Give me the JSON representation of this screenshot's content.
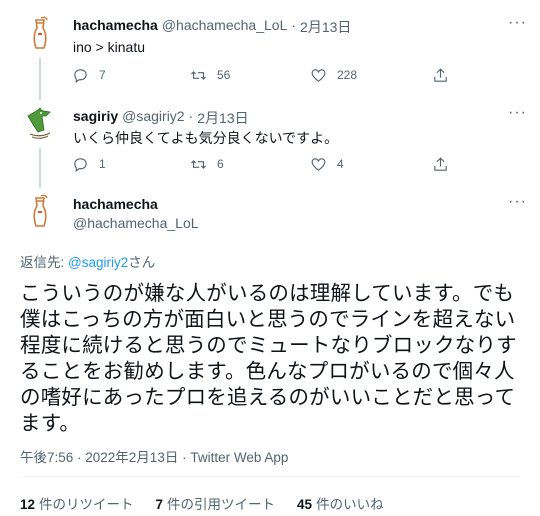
{
  "reply1": {
    "name": "hachamecha",
    "handle": "@hachamecha_LoL",
    "sep": "·",
    "date": "2月13日",
    "text": "ino > kinatu",
    "more": "···",
    "replies": "7",
    "retweets": "56",
    "likes": "228"
  },
  "reply2": {
    "name": "sagiriy",
    "handle": "@sagiriy2",
    "sep": "·",
    "date": "2月13日",
    "text": "いくら仲良くてよも気分良くないですよ。",
    "more": "···",
    "replies": "1",
    "retweets": "6",
    "likes": "4"
  },
  "main": {
    "name": "hachamecha",
    "handle": "@hachamecha_LoL",
    "more": "···",
    "reply_prefix": "返信先: ",
    "reply_to": "@sagiriy2",
    "reply_suffix": "さん",
    "text": "こういうのが嫌な人がいるのは理解しています。でも\n僕はこっちの方が面白いと思うのでラインを超えない\n程度に続けると思うのでミュートなりブロックなりす\nることをお勧めします。色んなプロがいるので個々人\nの嗜好にあったプロを追えるのがいいことだと思って\nます。",
    "timestamp": "午後7:56 · 2022年2月13日 · Twitter Web App",
    "retweet_count": "12",
    "retweet_label": "件のリツイート",
    "quote_count": "7",
    "quote_label": "件の引用ツイート",
    "like_count": "45",
    "like_label": "件のいいね"
  },
  "colors": {
    "link": "#1d9bf0",
    "secondary_text": "#536471",
    "divider": "#eff3f4"
  }
}
